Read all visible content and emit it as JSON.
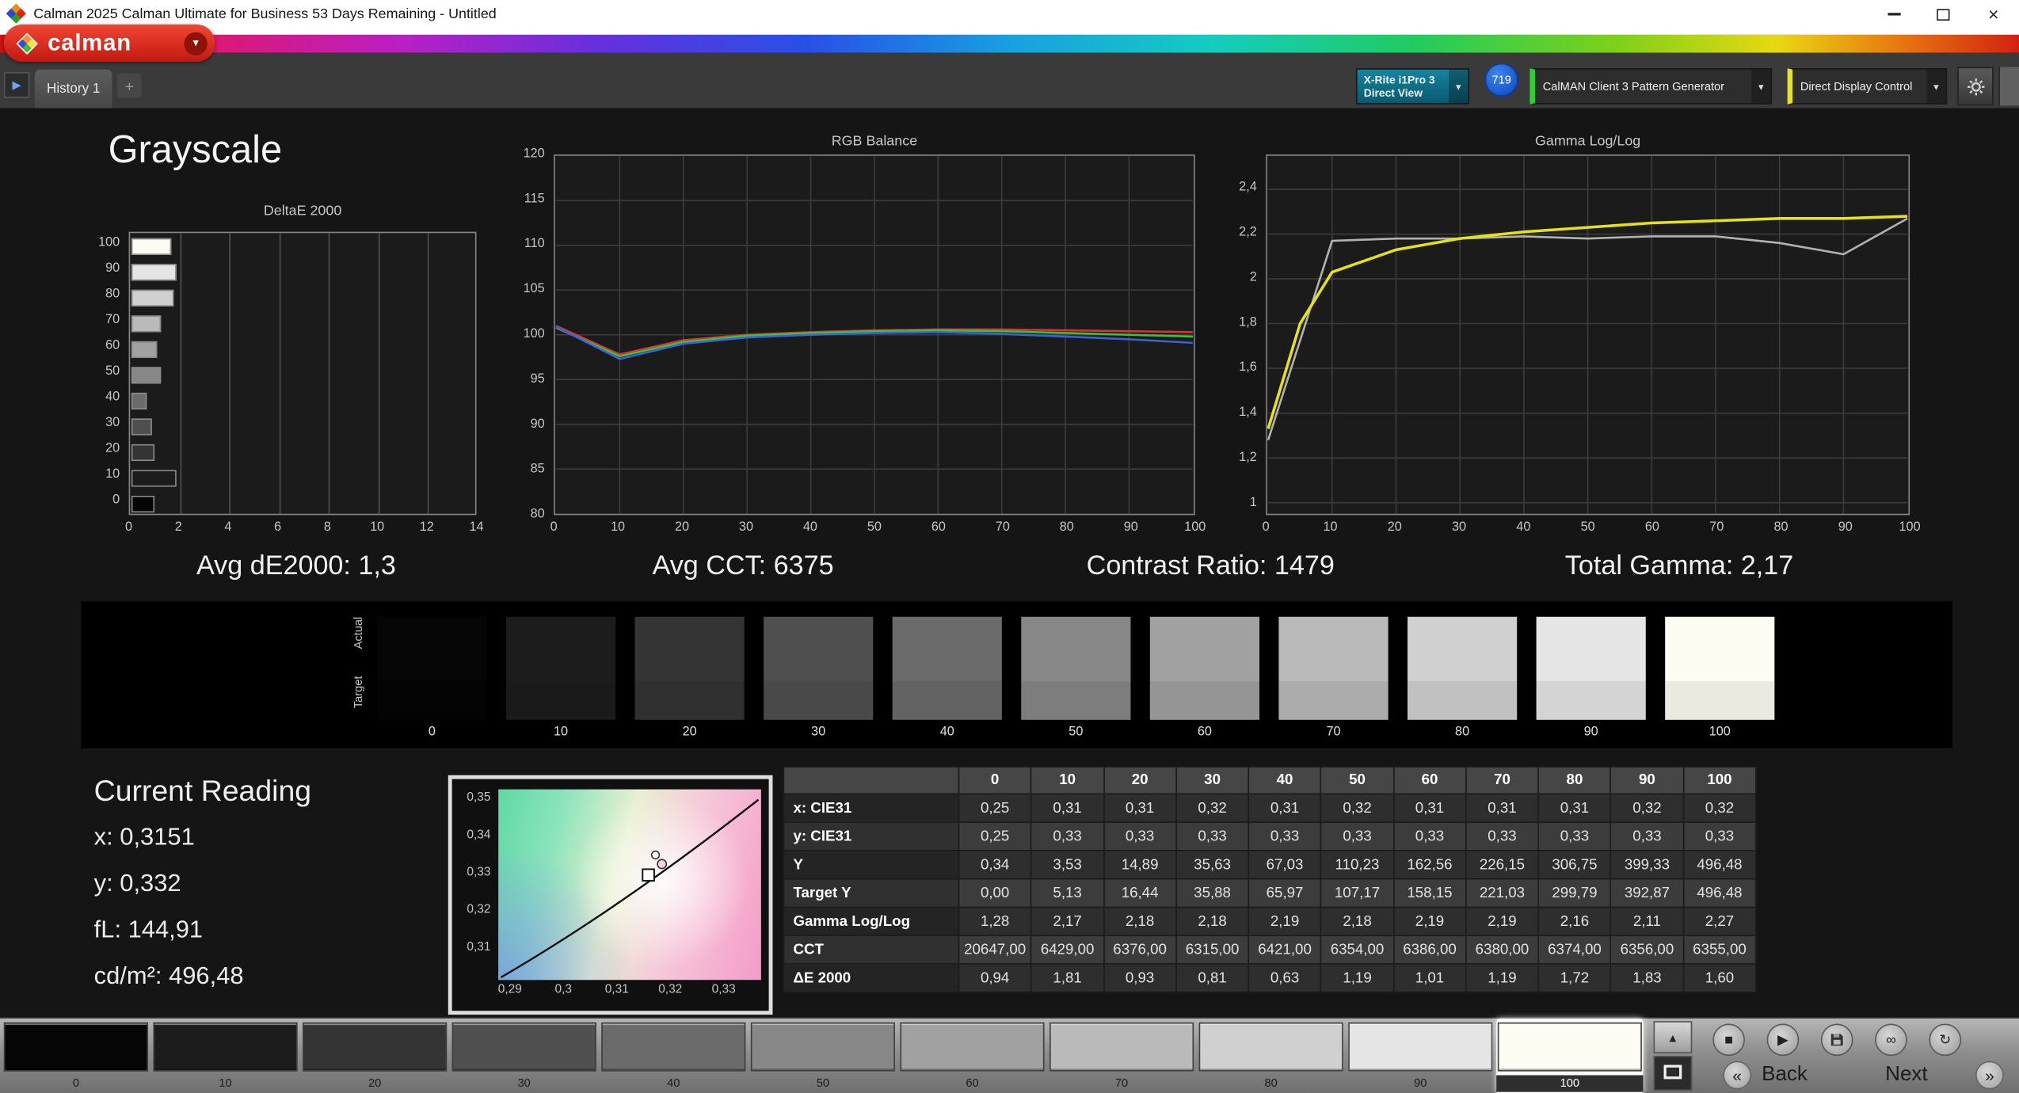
{
  "window": {
    "title": "Calman 2025 Calman Ultimate for Business 53 Days Remaining  - Untitled"
  },
  "brand": {
    "name": "calman"
  },
  "icons": {
    "close": "×",
    "caret": "▾",
    "plus": "+",
    "history_arrow": "▶",
    "up_arrow": "▲",
    "stop": "■",
    "play": "▶",
    "infinity": "∞",
    "refresh": "↻",
    "back_chevrons": "«",
    "next_chevrons": "»"
  },
  "toolbar": {
    "history_tab": "History 1",
    "meter_dropdown": {
      "line1": "X-Rite i1Pro 3",
      "line2": "Direct View"
    },
    "meter_badge": "719",
    "pattern_dropdown": "CalMAN Client 3 Pattern Generator",
    "display_dropdown": "Direct Display Control"
  },
  "page": {
    "title": "Grayscale"
  },
  "stats": {
    "avg_de2000": "Avg dE2000: 1,3",
    "avg_cct": "Avg CCT: 6375",
    "contrast_ratio": "Contrast Ratio: 1479",
    "total_gamma": "Total Gamma: 2,17"
  },
  "swatch_strip": {
    "actual_label": "Actual",
    "target_label": "Target",
    "labels": [
      "0",
      "10",
      "20",
      "30",
      "40",
      "50",
      "60",
      "70",
      "80",
      "90",
      "100"
    ],
    "colors": [
      "#050505",
      "#1c1c1c",
      "#343434",
      "#4f4f4f",
      "#6b6b6b",
      "#878787",
      "#a1a1a2",
      "#bababa",
      "#d0d0d0",
      "#e5e5e5",
      "#fdfbf2"
    ]
  },
  "current_reading": {
    "title": "Current Reading",
    "lines": [
      "x: 0,3151",
      "y: 0,332",
      "fL: 144,91",
      "cd/m²: 496,48"
    ]
  },
  "cie": {
    "yticks": [
      "0,35",
      "0,34",
      "0,33",
      "0,32",
      "0,31"
    ],
    "xticks": [
      "0,29",
      "0,3",
      "0,31",
      "0,32",
      "0,33"
    ]
  },
  "table": {
    "columns": [
      "",
      "0",
      "10",
      "20",
      "30",
      "40",
      "50",
      "60",
      "70",
      "80",
      "90",
      "100"
    ],
    "rows": [
      {
        "label": "x: CIE31",
        "values": [
          "0,25",
          "0,31",
          "0,31",
          "0,32",
          "0,31",
          "0,32",
          "0,31",
          "0,31",
          "0,31",
          "0,32",
          "0,32"
        ]
      },
      {
        "label": "y: CIE31",
        "values": [
          "0,25",
          "0,33",
          "0,33",
          "0,33",
          "0,33",
          "0,33",
          "0,33",
          "0,33",
          "0,33",
          "0,33",
          "0,33"
        ]
      },
      {
        "label": "Y",
        "values": [
          "0,34",
          "3,53",
          "14,89",
          "35,63",
          "67,03",
          "110,23",
          "162,56",
          "226,15",
          "306,75",
          "399,33",
          "496,48"
        ]
      },
      {
        "label": "Target Y",
        "values": [
          "0,00",
          "5,13",
          "16,44",
          "35,88",
          "65,97",
          "107,17",
          "158,15",
          "221,03",
          "299,79",
          "392,87",
          "496,48"
        ]
      },
      {
        "label": "Gamma Log/Log",
        "values": [
          "1,28",
          "2,17",
          "2,18",
          "2,18",
          "2,19",
          "2,18",
          "2,19",
          "2,19",
          "2,16",
          "2,11",
          "2,27"
        ]
      },
      {
        "label": "CCT",
        "values": [
          "20647,00",
          "6429,00",
          "6376,00",
          "6315,00",
          "6421,00",
          "6354,00",
          "6386,00",
          "6380,00",
          "6374,00",
          "6356,00",
          "6355,00"
        ]
      },
      {
        "label": "ΔE 2000",
        "values": [
          "0,94",
          "1,81",
          "0,93",
          "0,81",
          "0,63",
          "1,19",
          "1,01",
          "1,19",
          "1,72",
          "1,83",
          "1,60"
        ]
      }
    ]
  },
  "bottom_bar": {
    "labels": [
      "0",
      "10",
      "20",
      "30",
      "40",
      "50",
      "60",
      "70",
      "80",
      "90",
      "100"
    ],
    "selected_label": "100",
    "back": "Back",
    "next": "Next"
  },
  "chart_data": [
    {
      "id": "deltae",
      "type": "bar",
      "orientation": "horizontal",
      "title": "DeltaE 2000",
      "categories": [
        "0",
        "10",
        "20",
        "30",
        "40",
        "50",
        "60",
        "70",
        "80",
        "90",
        "100"
      ],
      "values": [
        0.94,
        1.81,
        0.93,
        0.81,
        0.63,
        1.19,
        1.01,
        1.19,
        1.72,
        1.83,
        1.6
      ],
      "xlim": [
        0,
        14
      ],
      "xlabel_ticks": [
        0,
        2,
        4,
        6,
        8,
        10,
        12,
        14
      ],
      "note": "levels ordered 100 at top to 0 at bottom; bar shade matches gray level"
    },
    {
      "id": "rgb_balance",
      "type": "line",
      "title": "RGB Balance",
      "ylim": [
        80,
        120
      ],
      "yticks": [
        120,
        115,
        110,
        105,
        100,
        95,
        90,
        85,
        80
      ],
      "xticks": [
        0,
        10,
        20,
        30,
        40,
        50,
        60,
        70,
        80,
        90,
        100
      ],
      "series": [
        {
          "name": "Red",
          "color": "#d83434",
          "width": 1.6,
          "x": [
            0,
            10,
            20,
            30,
            40,
            50,
            60,
            70,
            80,
            90,
            100
          ],
          "values": [
            101.0,
            97.8,
            99.4,
            100.0,
            100.3,
            100.5,
            100.6,
            100.6,
            100.5,
            100.4,
            100.3
          ]
        },
        {
          "name": "Green",
          "color": "#38c438",
          "width": 1.6,
          "x": [
            0,
            10,
            20,
            30,
            40,
            50,
            60,
            70,
            80,
            90,
            100
          ],
          "values": [
            100.8,
            97.6,
            99.2,
            99.9,
            100.2,
            100.4,
            100.5,
            100.4,
            100.2,
            100.0,
            99.8
          ]
        },
        {
          "name": "Blue",
          "color": "#3a62dd",
          "width": 1.6,
          "x": [
            0,
            10,
            20,
            30,
            40,
            50,
            60,
            70,
            80,
            90,
            100
          ],
          "values": [
            100.9,
            97.3,
            99.0,
            99.7,
            100.0,
            100.2,
            100.3,
            100.1,
            99.8,
            99.5,
            99.1
          ]
        }
      ]
    },
    {
      "id": "gamma_loglog",
      "type": "line",
      "title": "Gamma Log/Log",
      "ylim": [
        0.95,
        2.55
      ],
      "yticks_values": [
        2.4,
        2.2,
        2.0,
        1.8,
        1.6,
        1.4,
        1.2,
        1.0
      ],
      "yticks_labels": [
        "2,4",
        "2,2",
        "2",
        "1,8",
        "1,6",
        "1,4",
        "1,2",
        "1"
      ],
      "xticks": [
        0,
        10,
        20,
        30,
        40,
        50,
        60,
        70,
        80,
        90,
        100
      ],
      "series": [
        {
          "name": "Measured",
          "color": "#b2b2b2",
          "width": 1.6,
          "x": [
            0,
            10,
            20,
            30,
            40,
            50,
            60,
            70,
            80,
            90,
            100
          ],
          "values": [
            1.28,
            2.17,
            2.18,
            2.18,
            2.19,
            2.18,
            2.19,
            2.19,
            2.16,
            2.11,
            2.27
          ]
        },
        {
          "name": "Target",
          "color": "#e6e214",
          "width": 2.2,
          "x": [
            0,
            5,
            10,
            20,
            30,
            40,
            50,
            60,
            70,
            80,
            90,
            100
          ],
          "values": [
            1.33,
            1.8,
            2.03,
            2.13,
            2.18,
            2.21,
            2.23,
            2.25,
            2.26,
            2.27,
            2.27,
            2.28
          ]
        }
      ]
    }
  ],
  "colors": {
    "brand_red": "#d42015",
    "meter_teal": "#0f7a92",
    "pattern_green": "#2bd42b",
    "display_yellow": "#e8e12a",
    "badge_blue": "#1560e0"
  }
}
